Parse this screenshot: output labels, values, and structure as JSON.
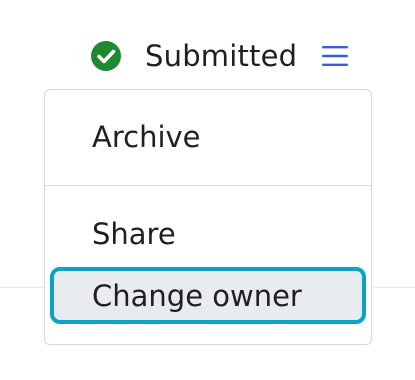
{
  "status": {
    "text": "Submitted",
    "icon": "check-circle-icon",
    "icon_color": "#1e8a2f"
  },
  "menu_toggle": {
    "icon": "hamburger-menu-icon",
    "color": "#3b5bdb"
  },
  "menu": {
    "items": [
      {
        "label": "Archive"
      },
      {
        "label": "Share"
      },
      {
        "label": "Change owner",
        "focused": true
      }
    ],
    "focus_color": "#0aa3c7"
  }
}
